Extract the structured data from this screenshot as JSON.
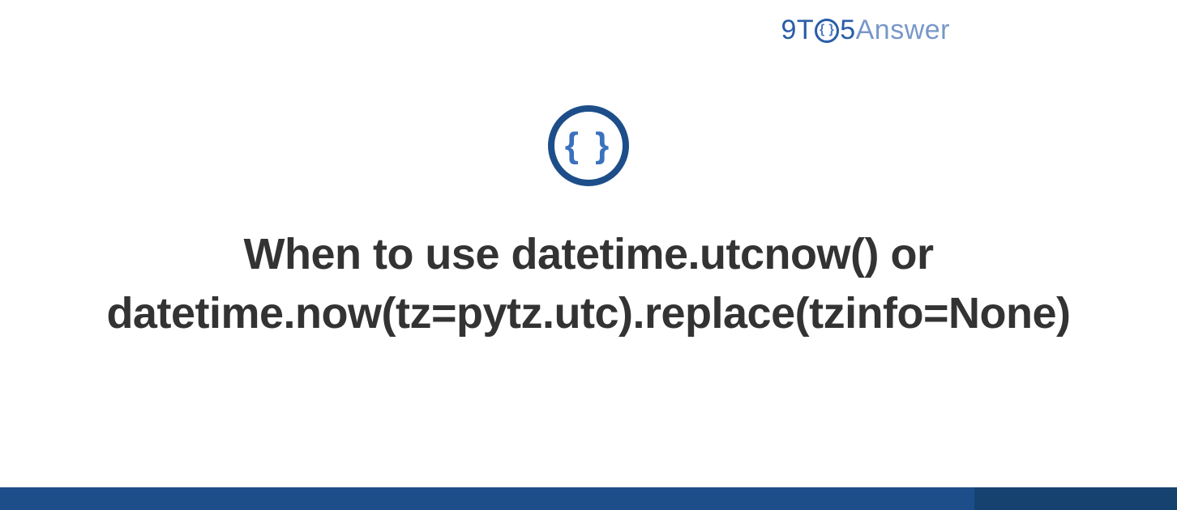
{
  "logo": {
    "part1": "9T",
    "braces": "{ }",
    "part2": "5",
    "part3": "Answer"
  },
  "icon": {
    "braces": "{ }"
  },
  "title": "When to use datetime.utcnow() or datetime.now(tz=pytz.utc).replace(tzinfo=None)"
}
